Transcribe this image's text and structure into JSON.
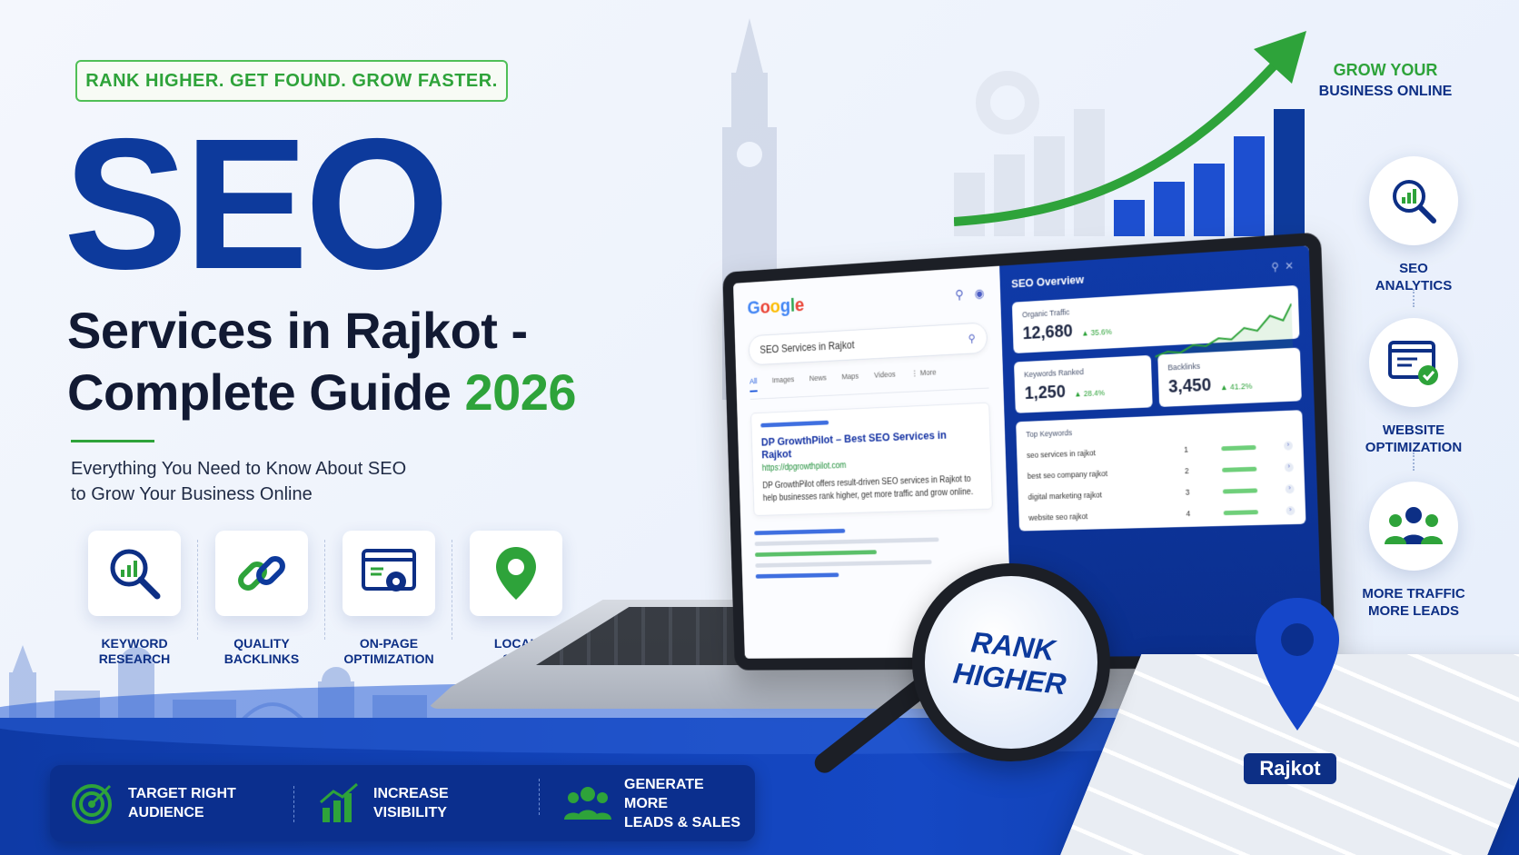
{
  "tagline": "RANK HIGHER. GET FOUND. GROW FASTER.",
  "hero": {
    "title": "SEO",
    "subtitle_line1": "Services in Rajkot -",
    "subtitle_line2": "Complete Guide ",
    "subtitle_year": "2026",
    "description": "Everything You Need to Know About SEO\nto Grow Your Business Online"
  },
  "features": [
    {
      "label": "KEYWORD\nRESEARCH",
      "icon": "magnifier-chart-icon"
    },
    {
      "label": "QUALITY\nBACKLINKS",
      "icon": "chain-link-icon"
    },
    {
      "label": "ON-PAGE\nOPTIMIZATION",
      "icon": "browser-gear-icon"
    },
    {
      "label": "LOCAL\nSEO",
      "icon": "location-pin-icon"
    }
  ],
  "benefits": [
    {
      "label": "TARGET RIGHT\nAUDIENCE",
      "icon": "target-icon"
    },
    {
      "label": "INCREASE\nVISIBILITY",
      "icon": "growth-bars-icon"
    },
    {
      "label": "GENERATE MORE\nLEADS & SALES",
      "icon": "team-icon"
    }
  ],
  "right_column": {
    "grow_line1": "GROW YOUR",
    "grow_line2": "BUSINESS ONLINE",
    "items": [
      {
        "label": "SEO\nANALYTICS",
        "icon": "analytics-icon"
      },
      {
        "label": "WEBSITE\nOPTIMIZATION",
        "icon": "website-check-icon"
      },
      {
        "label": "MORE TRAFFIC\nMORE LEADS",
        "icon": "people-icon"
      }
    ]
  },
  "google": {
    "logo_letters": [
      "G",
      "o",
      "o",
      "g",
      "l",
      "e"
    ],
    "search_query": "SEO Services in Rajkot",
    "tabs": [
      "All",
      "Images",
      "News",
      "Maps",
      "Videos",
      "⋮ More"
    ],
    "result_title": "DP GrowthPilot – Best SEO Services in Rajkot",
    "result_url": "https://dpgrowthpilot.com",
    "result_snippet": "DP GrowthPilot offers result-driven SEO services in Rajkot to help businesses rank higher, get more traffic and grow online."
  },
  "seo_overview": {
    "title": "SEO Overview",
    "organic_label": "Organic Traffic",
    "organic_value": "12,680",
    "organic_pct": "▲ 35.6%",
    "keywords_label": "Keywords Ranked",
    "keywords_value": "1,250",
    "keywords_pct": "▲ 28.4%",
    "backlinks_label": "Backlinks",
    "backlinks_value": "3,450",
    "backlinks_pct": "▲ 41.2%",
    "top_keywords_label": "Top Keywords",
    "top_keywords": [
      {
        "kw": "seo services in rajkot",
        "rank": "1"
      },
      {
        "kw": "best seo company rajkot",
        "rank": "2"
      },
      {
        "kw": "digital marketing rajkot",
        "rank": "3"
      },
      {
        "kw": "website seo rajkot",
        "rank": "4"
      }
    ]
  },
  "magnifier_text_line1": "RANK",
  "magnifier_text_line2": "HIGHER",
  "location_tag": "Rajkot",
  "colors": {
    "primary_blue": "#0d3a9c",
    "accent_green": "#2ea33a",
    "dark_navy": "#0b2f8e"
  }
}
